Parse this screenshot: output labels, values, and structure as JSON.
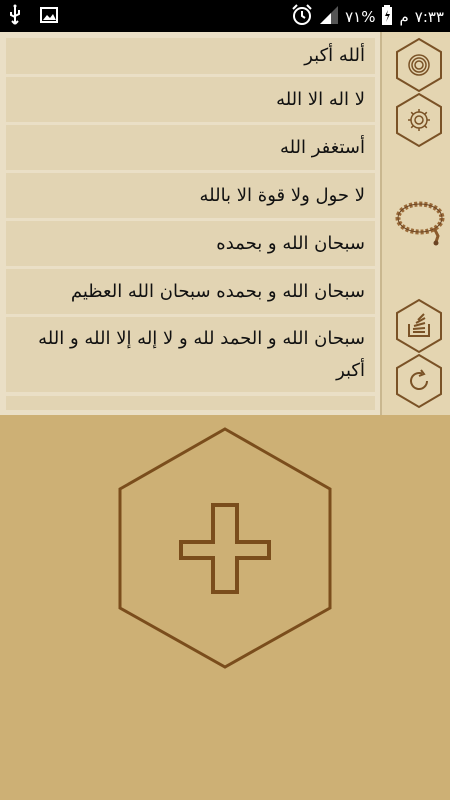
{
  "status_bar": {
    "time": "٧:٣٣",
    "ampm": "م",
    "battery": "٧١%",
    "icons": [
      "usb-icon",
      "image-icon",
      "alarm-icon",
      "signal-icon",
      "battery-icon"
    ]
  },
  "adhkar": [
    "ألله أكبر",
    "لا اله الا الله",
    "أستغفر الله",
    "لا حول ولا قوة الا بالله",
    "سبحان الله و بحمده",
    "سبحان الله و بحمده سبحان الله العظيم",
    "سبحان الله و الحمد لله و لا إله إلا الله و الله أكبر"
  ],
  "side_buttons": [
    "vibrate-settings-icon",
    "gear-icon",
    "prayer-beads-icon",
    "stack-icon",
    "refresh-icon"
  ],
  "counter": {
    "icon": "plus-icon"
  },
  "colors": {
    "accent": "#7a5226",
    "bg": "#cdb075",
    "list_bg": "#e2d4b3"
  }
}
